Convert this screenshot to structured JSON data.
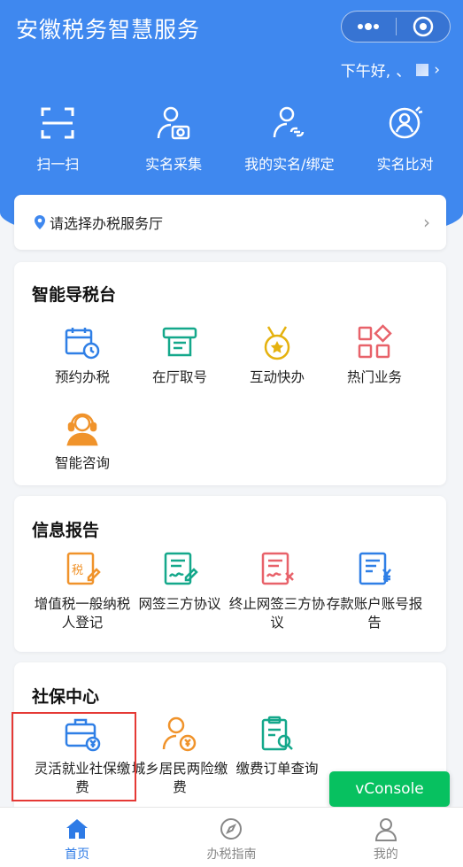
{
  "app": {
    "title": "安徽税务智慧服务"
  },
  "capsule": {
    "more_glyph": "•••",
    "close_glyph": "◉"
  },
  "greeting": {
    "text": "下午好,",
    "name_mark": "、",
    "chevron": "›"
  },
  "quick_actions": [
    {
      "label": "扫一扫",
      "icon": "scan-icon"
    },
    {
      "label": "实名采集",
      "icon": "camera-user-icon"
    },
    {
      "label": "我的实名/绑定",
      "icon": "user-link-icon"
    },
    {
      "label": "实名比对",
      "icon": "face-compare-icon"
    }
  ],
  "hall_selector": {
    "label": "请选择办税服务厅",
    "chevron": "›"
  },
  "sections": {
    "guide": {
      "title": "智能导税台",
      "items": [
        {
          "label": "预约办税",
          "icon": "calendar-clock-icon"
        },
        {
          "label": "在厅取号",
          "icon": "ticket-printer-icon"
        },
        {
          "label": "互动快办",
          "icon": "medal-icon"
        },
        {
          "label": "热门业务",
          "icon": "grid-apps-icon"
        },
        {
          "label": "智能咨询",
          "icon": "headset-agent-icon"
        }
      ]
    },
    "report": {
      "title": "信息报告",
      "items": [
        {
          "label": "增值税一般纳税人登记",
          "icon": "tax-edit-icon"
        },
        {
          "label": "网签三方协议",
          "icon": "sign-doc-icon"
        },
        {
          "label": "终止网签三方协议",
          "icon": "cancel-doc-icon"
        },
        {
          "label": "存款账户账号报告",
          "icon": "yuan-doc-icon"
        }
      ]
    },
    "social": {
      "title": "社保中心",
      "items": [
        {
          "label": "灵活就业社保缴费",
          "icon": "briefcase-yuan-icon"
        },
        {
          "label": "城乡居民两险缴费",
          "icon": "user-yuan-icon"
        },
        {
          "label": "缴费订单查询",
          "icon": "clipboard-search-icon"
        }
      ]
    }
  },
  "vconsole": {
    "label": "vConsole"
  },
  "tabbar": [
    {
      "label": "首页",
      "icon": "home-icon",
      "active": true
    },
    {
      "label": "办税指南",
      "icon": "compass-icon",
      "active": false
    },
    {
      "label": "我的",
      "icon": "user-icon",
      "active": false
    }
  ],
  "colors": {
    "brand": "#3f88ef",
    "active_tab": "#2e7be6",
    "vconsole": "#07c160",
    "highlight": "#e53935"
  }
}
